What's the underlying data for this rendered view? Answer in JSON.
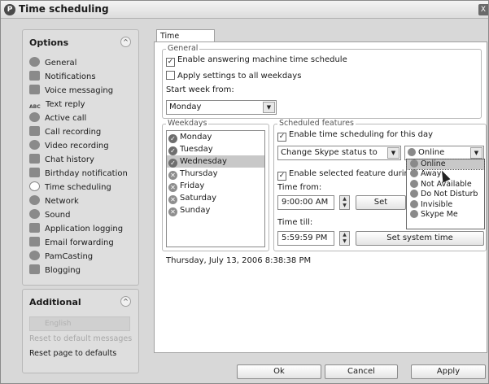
{
  "window": {
    "title": "Time scheduling",
    "close_label": "X"
  },
  "sidebar": {
    "header": "Options",
    "items": [
      {
        "label": "General",
        "icon": "skype-general-icon"
      },
      {
        "label": "Notifications",
        "icon": "bell-icon"
      },
      {
        "label": "Voice messaging",
        "icon": "voicemail-icon"
      },
      {
        "label": "Text reply",
        "icon": "abc-icon"
      },
      {
        "label": "Active call",
        "icon": "phone-icon"
      },
      {
        "label": "Call recording",
        "icon": "recorder-icon"
      },
      {
        "label": "Video recording",
        "icon": "webcam-icon"
      },
      {
        "label": "Chat history",
        "icon": "chat-icon"
      },
      {
        "label": "Birthday notification",
        "icon": "calendar-icon"
      },
      {
        "label": "Time scheduling",
        "icon": "clock-icon"
      },
      {
        "label": "Network",
        "icon": "network-icon"
      },
      {
        "label": "Sound",
        "icon": "speaker-icon"
      },
      {
        "label": "Application logging",
        "icon": "log-icon"
      },
      {
        "label": "Email forwarding",
        "icon": "email-icon"
      },
      {
        "label": "PamCasting",
        "icon": "pamcasting-icon"
      },
      {
        "label": "Blogging",
        "icon": "blog-icon"
      }
    ]
  },
  "additional": {
    "header": "Additional",
    "language_value": "English",
    "reset_messages": "Reset to default messages",
    "reset_page": "Reset page to defaults"
  },
  "tab": {
    "label": "Time scheduling"
  },
  "general": {
    "legend": "General",
    "enable_label": "Enable answering machine time schedule",
    "apply_all_label": "Apply settings to all weekdays",
    "start_week_label": "Start week from:",
    "start_week_value": "Monday"
  },
  "weekdays": {
    "legend": "Weekdays",
    "days": [
      "Monday",
      "Tuesday",
      "Wednesday",
      "Thursday",
      "Friday",
      "Saturday",
      "Sunday"
    ]
  },
  "scheduled": {
    "legend": "Scheduled features",
    "enable_label": "Enable time scheduling for this day",
    "feature_value": "Change Skype status to",
    "status_value": "Online",
    "enable_selected_label": "Enable selected feature during th",
    "time_from_label": "Time from:",
    "time_from_value": "9:00:00 AM",
    "set_button_top": "Set",
    "time_till_label": "Time till:",
    "time_till_value": "5:59:59 PM",
    "set_system_time": "Set system time"
  },
  "status_options": [
    "Online",
    "Away",
    "Not Available",
    "Do Not Disturb",
    "Invisible",
    "Skype Me"
  ],
  "datetime": "Thursday, July 13, 2006 8:38:38 PM",
  "footer": {
    "ok": "Ok",
    "cancel": "Cancel",
    "apply": "Apply"
  }
}
